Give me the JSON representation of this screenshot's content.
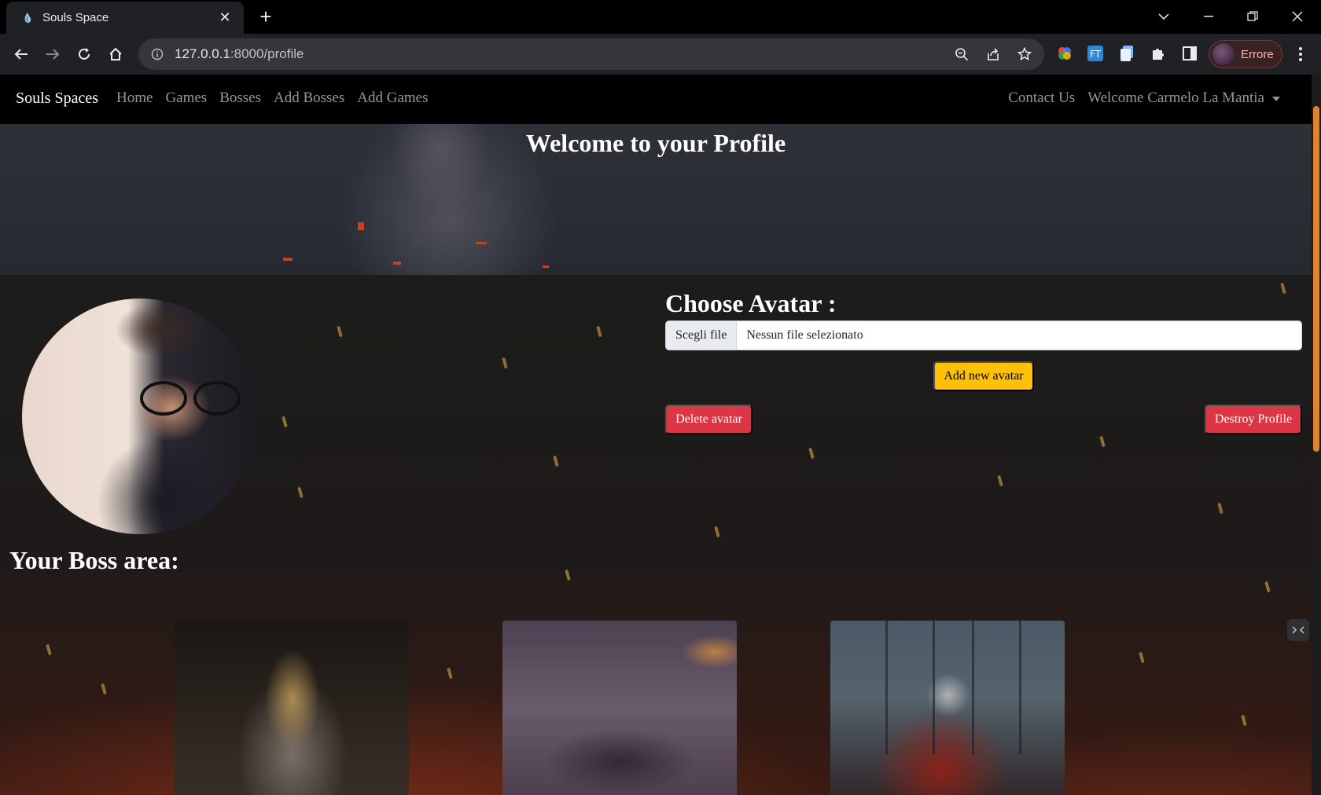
{
  "browser": {
    "tab_title": "Souls Space",
    "url_host": "127.0.0.1",
    "url_rest": ":8000/profile",
    "profile_label": "Errore"
  },
  "navbar": {
    "brand": "Souls Spaces",
    "links": [
      "Home",
      "Games",
      "Bosses",
      "Add Bosses",
      "Add Games"
    ],
    "contact": "Contact Us",
    "user_menu": "Welcome Carmelo La Mantia"
  },
  "hero": {
    "title": "Welcome to your Profile"
  },
  "avatar_section": {
    "title": "Choose Avatar :",
    "file_button": "Scegli file",
    "file_status": "Nessun file selezionato",
    "add_button": "Add new avatar",
    "delete_button": "Delete avatar",
    "destroy_button": "Destroy Profile"
  },
  "boss_area": {
    "title": "Your Boss area:"
  },
  "colors": {
    "warning": "#ffc107",
    "danger": "#dc3545",
    "navbar_bg": "#000000",
    "scroll_thumb": "#e0842c"
  }
}
